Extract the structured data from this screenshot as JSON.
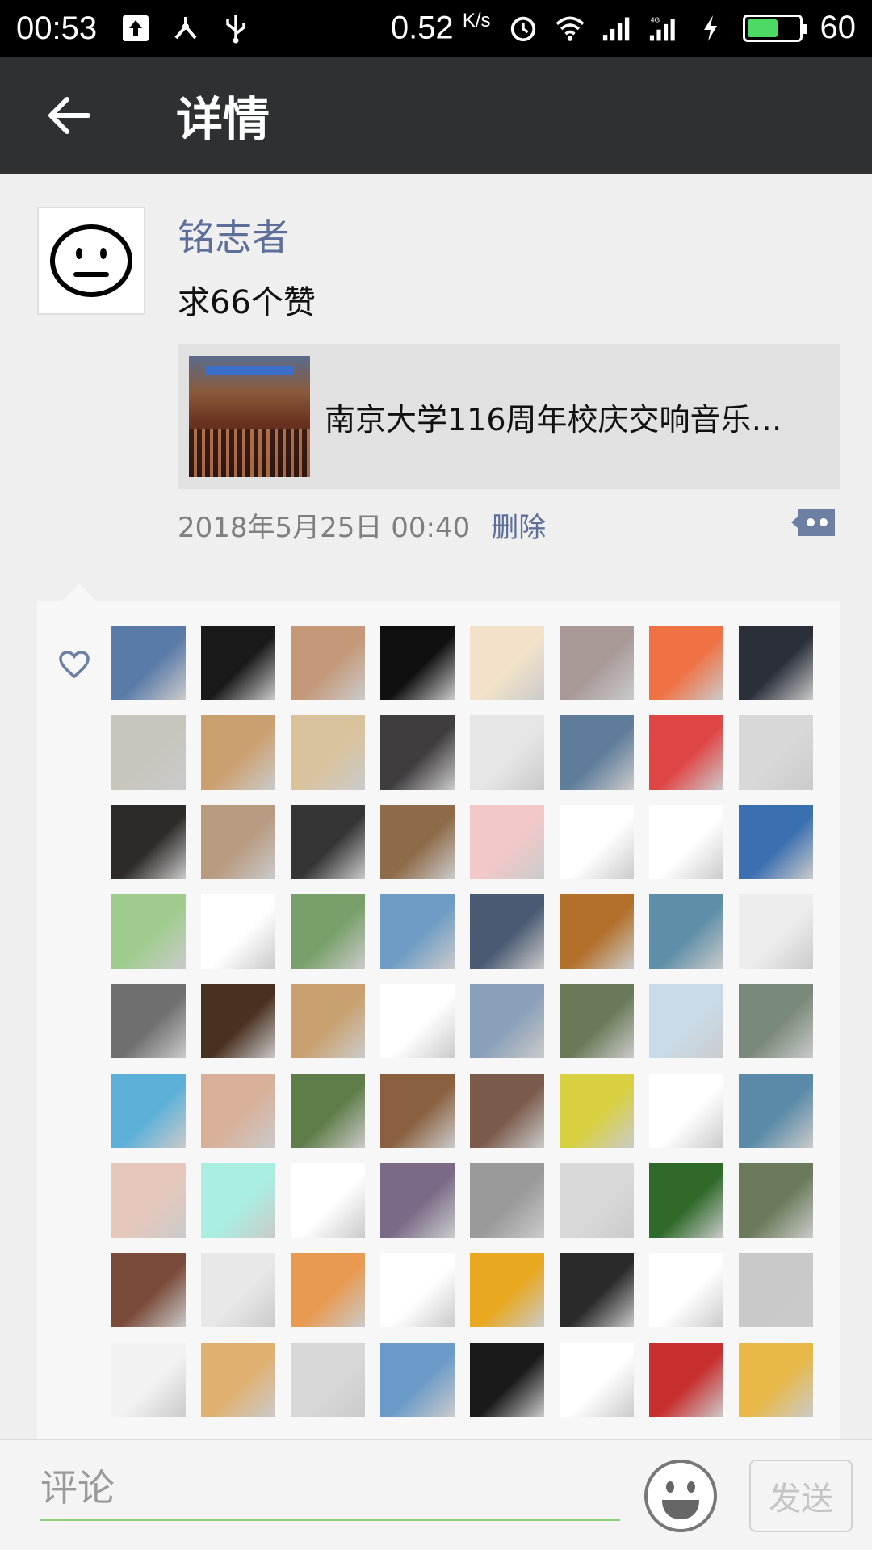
{
  "status_bar": {
    "time": "00:53",
    "net_speed": "0.52",
    "net_unit": "K/s",
    "battery": "60",
    "battery_level": 0.6,
    "icons": [
      "upload-icon",
      "usb-share-icon",
      "usb-icon",
      "alarm-icon",
      "wifi-icon",
      "signal-icon",
      "signal-4g-icon",
      "charging-icon",
      "battery-icon"
    ]
  },
  "toolbar": {
    "title": "详情",
    "back_icon": "arrow-left-icon"
  },
  "post": {
    "username": "铭志者",
    "content": "求66个赞",
    "link_title": "南京大学116周年校庆交响音乐…",
    "timestamp": "2018年5月25日 00:40",
    "delete_label": "删除"
  },
  "likes": {
    "icon": "heart-icon",
    "avatar_colors": [
      "#5a7aa8",
      "#1a1a1a",
      "#c49878",
      "#101010",
      "#f3e2c9",
      "#a99a98",
      "#f07244",
      "#2a2f3a",
      "#c8c5bd",
      "#cba070",
      "#d9c39d",
      "#403d3f",
      "#e6e6e6",
      "#5f7d9a",
      "#e04545",
      "#d8d8d8",
      "#2e2a28",
      "#b89a80",
      "#353535",
      "#8d6a48",
      "#f2c8c8",
      "#ffffff",
      "#ffffff",
      "#3a6fb0",
      "#9fcc8e",
      "#ffffff",
      "#79a06a",
      "#6f9cc4",
      "#4a5a72",
      "#b3702a",
      "#5f8fa8",
      "#ededed",
      "#6f6f6f",
      "#4a3020",
      "#c9a170",
      "#ffffff",
      "#8aa0b8",
      "#6a7a58",
      "#c9dbe8",
      "#7a8a7a",
      "#5cb0d8",
      "#d8b09a",
      "#5f7d48",
      "#8a6040",
      "#7a5a4a",
      "#d8d040",
      "#ffffff",
      "#5a8aa8",
      "#e6c7bb",
      "#a9eee0",
      "#ffffff",
      "#7a6a88",
      "#9a9a9a",
      "#d9d9d9",
      "#2f6a2a",
      "#6a7a5a",
      "#7a4a3a",
      "#e8e8e8",
      "#e89a50",
      "#ffffff",
      "#e8a820",
      "#2a2a2a",
      "#ffffff",
      "#c9c9c9",
      "#f2f2f2",
      "#e0b070",
      "#d8d8d8",
      "#6a9ac8",
      "#1a1a1a",
      "#ffffff",
      "#c83030",
      "#e8b848"
    ]
  },
  "input_bar": {
    "placeholder": "评论",
    "send_label": "发送",
    "emoji_icon": "smiley-icon"
  }
}
